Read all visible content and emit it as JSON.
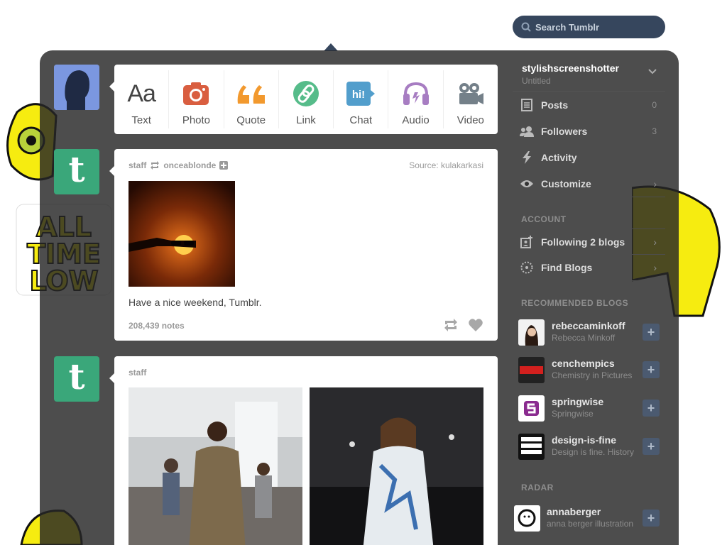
{
  "search": {
    "placeholder": "Search Tumblr"
  },
  "post_types": [
    {
      "label": "Text",
      "icon": "text-icon",
      "color": "#444444"
    },
    {
      "label": "Photo",
      "icon": "camera-icon",
      "color": "#d95e40"
    },
    {
      "label": "Quote",
      "icon": "quote-icon",
      "color": "#f2992e"
    },
    {
      "label": "Link",
      "icon": "link-icon",
      "color": "#56bc8a"
    },
    {
      "label": "Chat",
      "icon": "chat-icon",
      "color": "#529ecc"
    },
    {
      "label": "Audio",
      "icon": "headphones-icon",
      "color": "#a77dc2"
    },
    {
      "label": "Video",
      "icon": "video-camera-icon",
      "color": "#748089"
    }
  ],
  "posts": [
    {
      "author": "staff",
      "reblogged_from": "onceablonde",
      "source_label": "Source:",
      "source": "kulakarkasi",
      "caption": "Have a nice weekend, Tumblr.",
      "notes": "208,439 notes"
    },
    {
      "author": "staff"
    }
  ],
  "avatar_letter": "t",
  "sidebar": {
    "account_name": "stylishscreenshotter",
    "account_sub": "Untitled",
    "items": [
      {
        "label": "Posts",
        "count": "0",
        "icon": "posts-icon"
      },
      {
        "label": "Followers",
        "count": "3",
        "icon": "followers-icon"
      },
      {
        "label": "Activity",
        "icon": "lightning-icon"
      },
      {
        "label": "Customize",
        "arrow": "›",
        "icon": "eye-icon"
      }
    ],
    "account_heading": "ACCOUNT",
    "account_items": [
      {
        "label": "Following 2 blogs",
        "arrow": "›",
        "icon": "following-icon"
      },
      {
        "label": "Find Blogs",
        "arrow": "›",
        "icon": "compass-icon"
      }
    ],
    "recommended_heading": "RECOMMENDED BLOGS",
    "recommended": [
      {
        "name": "rebeccaminkoff",
        "sub": "Rebecca Minkoff"
      },
      {
        "name": "cenchempics",
        "sub": "Chemistry in Pictures"
      },
      {
        "name": "springwise",
        "sub": "Springwise"
      },
      {
        "name": "design-is-fine",
        "sub": "Design is fine. History"
      }
    ],
    "radar_heading": "RADAR",
    "radar": {
      "name": "annaberger",
      "sub": "anna berger illustration"
    },
    "plus": "+"
  },
  "colors": {
    "accent": "#36465d",
    "tumblr_green": "#3aa77a"
  }
}
